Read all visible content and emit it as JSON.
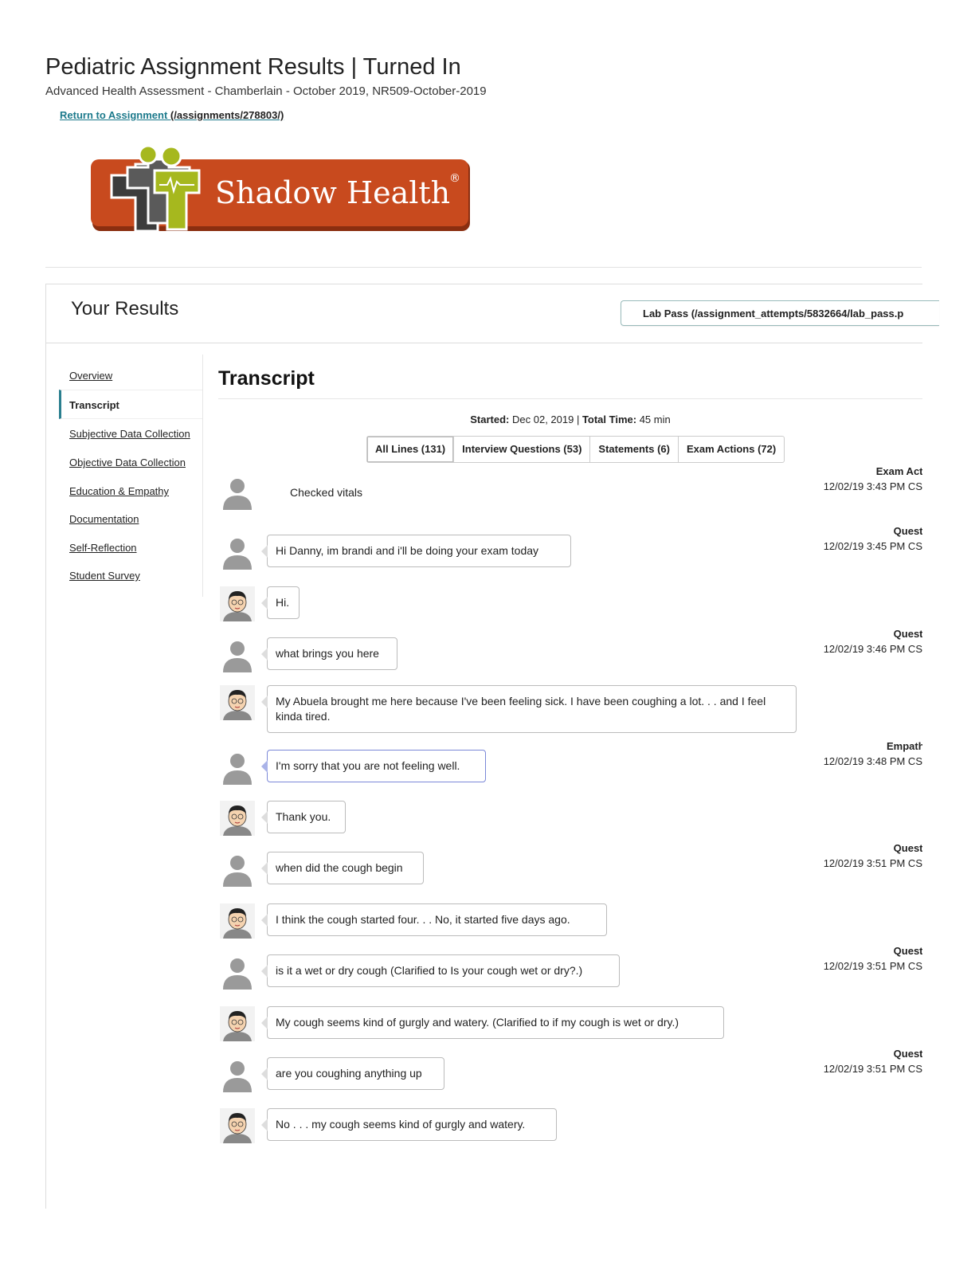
{
  "page": {
    "title": "Pediatric Assignment Results | Turned In",
    "subtitle": "Advanced Health Assessment - Chamberlain - October 2019, NR509-October-2019",
    "return_label": "Return to Assignment ",
    "return_path": "(/assignments/278803/)"
  },
  "logo": {
    "text": "Shadow Health",
    "reg": "®"
  },
  "results": {
    "title": "Your Results",
    "lab_pass": "Lab Pass (/assignment_attempts/5832664/lab_pass.p"
  },
  "nav": [
    "Overview",
    "Transcript",
    "Subjective Data Collection",
    "Objective Data Collection",
    "Education & Empathy",
    "Documentation",
    "Self-Reflection",
    "Student Survey"
  ],
  "transcript": {
    "title": "Transcript",
    "started_label": "Started:",
    "started_value": " Dec 02, 2019 | ",
    "total_label": "Total Time:",
    "total_value": " 45 min",
    "tabs": [
      "All Lines (131)",
      "Interview Questions (53)",
      "Statements (6)",
      "Exam Actions (72)"
    ],
    "lines": [
      {
        "speaker": "student",
        "text": "Checked vitals",
        "type": "Exam Action",
        "time": "12/02/19 3:43 PM CS"
      },
      {
        "speaker": "student",
        "text": "Hi Danny, im brandi and i'll be doing your exam today",
        "type": "Question",
        "time": "12/02/19 3:45 PM CS"
      },
      {
        "speaker": "patient",
        "text": "Hi."
      },
      {
        "speaker": "student",
        "text": "what brings you here",
        "type": "Question",
        "time": "12/02/19 3:46 PM CS"
      },
      {
        "speaker": "patient",
        "text": "My Abuela brought me here because I've been feeling sick. I have been coughing a lot. . . and I feel kinda tired."
      },
      {
        "speaker": "student",
        "text": "I'm sorry that you are not feeling well.",
        "type": "Empathize",
        "time": "12/02/19 3:48 PM CS"
      },
      {
        "speaker": "patient",
        "text": "Thank you."
      },
      {
        "speaker": "student",
        "text": "when did the cough begin",
        "type": "Question",
        "time": "12/02/19 3:51 PM CS"
      },
      {
        "speaker": "patient",
        "text": "I think the cough started four. . . No, it started five days ago."
      },
      {
        "speaker": "student",
        "text": "is it a wet or dry cough (Clarified to Is your cough wet or dry?.)",
        "type": "Question",
        "time": "12/02/19 3:51 PM CS"
      },
      {
        "speaker": "patient",
        "text": "My cough seems kind of gurgly and watery. (Clarified to if my cough is wet or dry.)"
      },
      {
        "speaker": "student",
        "text": "are you coughing anything up",
        "type": "Question",
        "time": "12/02/19 3:51 PM CS"
      },
      {
        "speaker": "patient",
        "text": "No . . . my cough seems kind of gurgly and watery."
      }
    ]
  },
  "colors": {
    "accent": "#2a7f8f",
    "link": "#1d7a8c",
    "logo_bg": "#c84a1e",
    "logo_green": "#a6b81e"
  }
}
